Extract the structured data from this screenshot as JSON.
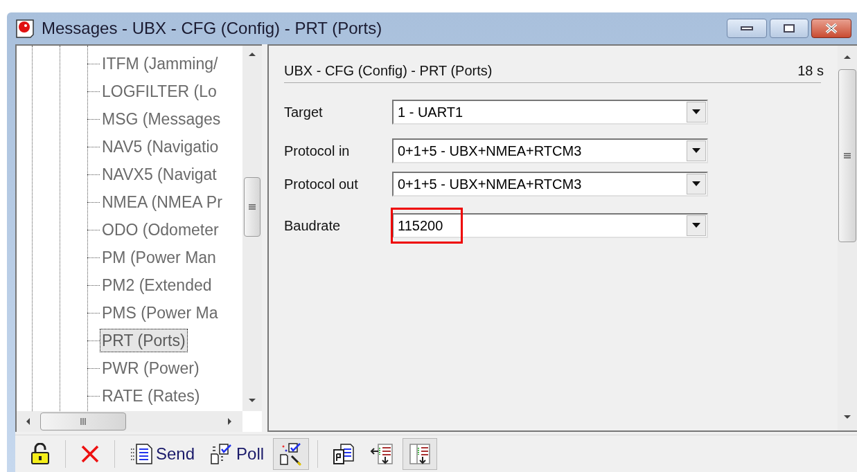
{
  "window": {
    "title": "Messages - UBX - CFG (Config) - PRT (Ports)"
  },
  "tree": {
    "items": [
      {
        "label": "ITFM (Jamming/",
        "selected": false
      },
      {
        "label": "LOGFILTER (Lo",
        "selected": false
      },
      {
        "label": "MSG (Messages",
        "selected": false
      },
      {
        "label": "NAV5 (Navigatio",
        "selected": false
      },
      {
        "label": "NAVX5 (Navigat",
        "selected": false
      },
      {
        "label": "NMEA (NMEA Pr",
        "selected": false
      },
      {
        "label": "ODO (Odometer",
        "selected": false
      },
      {
        "label": "PM (Power Man",
        "selected": false
      },
      {
        "label": "PM2 (Extended",
        "selected": false
      },
      {
        "label": "PMS (Power Ma",
        "selected": false
      },
      {
        "label": "PRT (Ports)",
        "selected": true
      },
      {
        "label": "PWR (Power)",
        "selected": false
      },
      {
        "label": "RATE (Rates)",
        "selected": false
      }
    ]
  },
  "panel": {
    "heading": "UBX - CFG (Config) - PRT (Ports)",
    "timer": "18 s",
    "fields": [
      {
        "label": "Target",
        "value": "1 - UART1",
        "highlighted": false
      },
      {
        "label": "Protocol in",
        "value": "0+1+5 - UBX+NMEA+RTCM3",
        "highlighted": false
      },
      {
        "label": "Protocol out",
        "value": "0+1+5 - UBX+NMEA+RTCM3",
        "highlighted": false
      },
      {
        "label": "Baudrate",
        "value": "115200",
        "highlighted": true
      }
    ]
  },
  "toolbar": [
    {
      "kind": "lock",
      "pressed": false
    },
    {
      "kind": "separator"
    },
    {
      "kind": "delete",
      "pressed": false
    },
    {
      "kind": "separator"
    },
    {
      "kind": "send",
      "label": "Send",
      "pressed": false
    },
    {
      "kind": "poll",
      "label": "Poll",
      "pressed": false
    },
    {
      "kind": "auto-poll",
      "pressed": true
    },
    {
      "kind": "separator"
    },
    {
      "kind": "copy",
      "pressed": false
    },
    {
      "kind": "insert",
      "pressed": false
    },
    {
      "kind": "append",
      "pressed": true
    }
  ]
}
